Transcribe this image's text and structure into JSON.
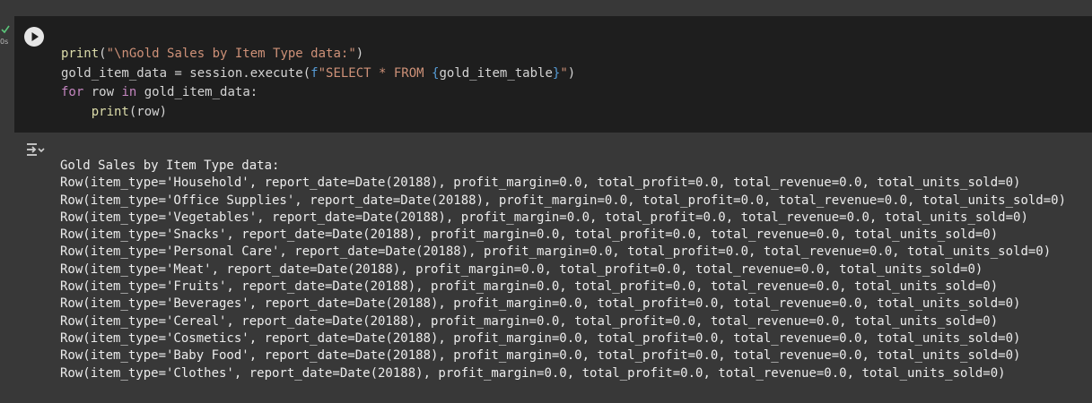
{
  "cell": {
    "exec_time": "0s",
    "code": {
      "line1": {
        "fn": "print",
        "open": "(",
        "str": "\"\\nGold Sales by Item Type data:\"",
        "close": ")"
      },
      "line2": {
        "var": "gold_item_data = session.execute(",
        "fprefix": "f",
        "str_a": "\"SELECT * FROM ",
        "brace_open": "{",
        "inner": "gold_item_table",
        "brace_close": "}",
        "str_b": "\"",
        "close": ")"
      },
      "line3": {
        "kw_for": "for",
        "mid1": " row ",
        "kw_in": "in",
        "mid2": " gold_item_data:"
      },
      "line4": {
        "indent": "    ",
        "fn": "print",
        "rest": "(row)"
      }
    }
  },
  "output": {
    "header": "Gold Sales by Item Type data:",
    "rows": [
      "Row(item_type='Household', report_date=Date(20188), profit_margin=0.0, total_profit=0.0, total_revenue=0.0, total_units_sold=0)",
      "Row(item_type='Office Supplies', report_date=Date(20188), profit_margin=0.0, total_profit=0.0, total_revenue=0.0, total_units_sold=0)",
      "Row(item_type='Vegetables', report_date=Date(20188), profit_margin=0.0, total_profit=0.0, total_revenue=0.0, total_units_sold=0)",
      "Row(item_type='Snacks', report_date=Date(20188), profit_margin=0.0, total_profit=0.0, total_revenue=0.0, total_units_sold=0)",
      "Row(item_type='Personal Care', report_date=Date(20188), profit_margin=0.0, total_profit=0.0, total_revenue=0.0, total_units_sold=0)",
      "Row(item_type='Meat', report_date=Date(20188), profit_margin=0.0, total_profit=0.0, total_revenue=0.0, total_units_sold=0)",
      "Row(item_type='Fruits', report_date=Date(20188), profit_margin=0.0, total_profit=0.0, total_revenue=0.0, total_units_sold=0)",
      "Row(item_type='Beverages', report_date=Date(20188), profit_margin=0.0, total_profit=0.0, total_revenue=0.0, total_units_sold=0)",
      "Row(item_type='Cereal', report_date=Date(20188), profit_margin=0.0, total_profit=0.0, total_revenue=0.0, total_units_sold=0)",
      "Row(item_type='Cosmetics', report_date=Date(20188), profit_margin=0.0, total_profit=0.0, total_revenue=0.0, total_units_sold=0)",
      "Row(item_type='Baby Food', report_date=Date(20188), profit_margin=0.0, total_profit=0.0, total_revenue=0.0, total_units_sold=0)",
      "Row(item_type='Clothes', report_date=Date(20188), profit_margin=0.0, total_profit=0.0, total_revenue=0.0, total_units_sold=0)"
    ]
  },
  "icons": {
    "status": "check-icon",
    "run": "play-icon",
    "output_menu": "output-menu-icon"
  },
  "colors": {
    "background": "#383838",
    "cell_background": "#1e1e1e",
    "success": "#5bc57a",
    "function": "#dcdcaa",
    "string": "#ce9178",
    "keyword": "#c586c0",
    "brace": "#569cd6"
  }
}
